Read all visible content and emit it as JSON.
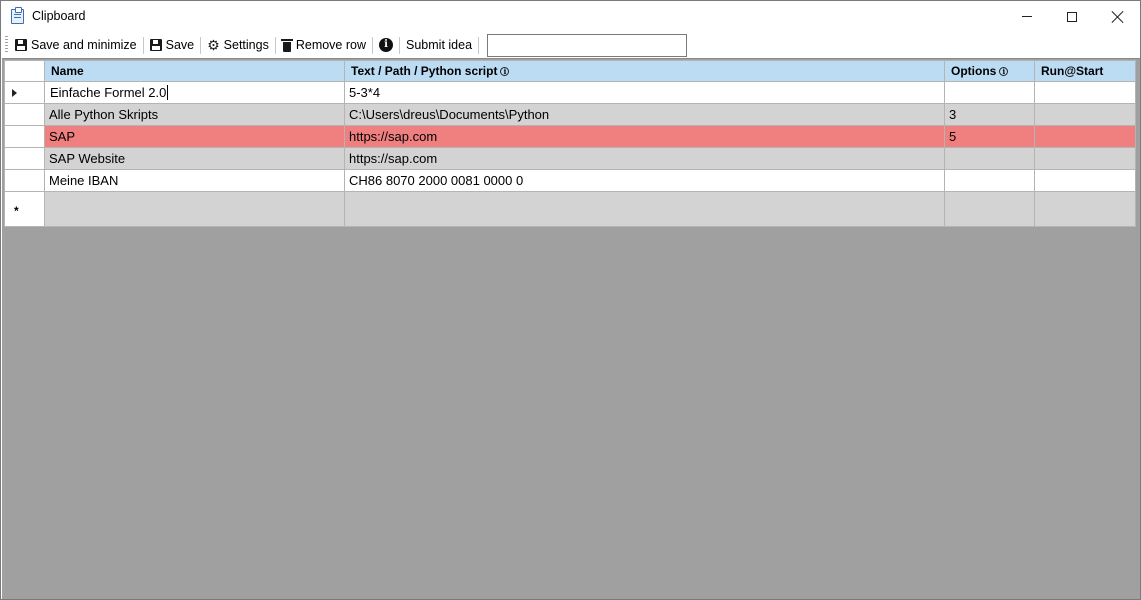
{
  "window": {
    "title": "Clipboard"
  },
  "toolbar": {
    "save_minimize_label": "Save and minimize",
    "save_label": "Save",
    "settings_label": "Settings",
    "remove_row_label": "Remove row",
    "info_label": "i",
    "submit_idea_label": "Submit idea",
    "search_value": ""
  },
  "grid": {
    "columns": [
      {
        "label": "Name",
        "hint": ""
      },
      {
        "label": "Text / Path / Python script",
        "hint": "i"
      },
      {
        "label": "Options",
        "hint": "i"
      },
      {
        "label": "Run@Start",
        "hint": ""
      }
    ],
    "rows": [
      {
        "name": "Einfache Formel 2.0",
        "text": "5-3*4",
        "options": "",
        "run_at_start": "",
        "style": "white",
        "current": true
      },
      {
        "name": "Alle Python Skripts",
        "text": "C:\\Users\\dreus\\Documents\\Python",
        "options": "3",
        "run_at_start": "",
        "style": "gray"
      },
      {
        "name": "SAP",
        "text": "https://sap.com",
        "options": "5",
        "run_at_start": "",
        "style": "selected"
      },
      {
        "name": "SAP Website",
        "text": "https://sap.com",
        "options": "",
        "run_at_start": "",
        "style": "gray"
      },
      {
        "name": "Meine IBAN",
        "text": "CH86 8070 2000 0081 0000 0",
        "options": "",
        "run_at_start": "",
        "style": "white"
      }
    ],
    "new_row_marker": "*"
  },
  "colors": {
    "header_bg": "#bcdcf4",
    "selected_row": "#f08080",
    "alt_row": "#d3d3d3",
    "empty_area": "#a0a0a0"
  }
}
